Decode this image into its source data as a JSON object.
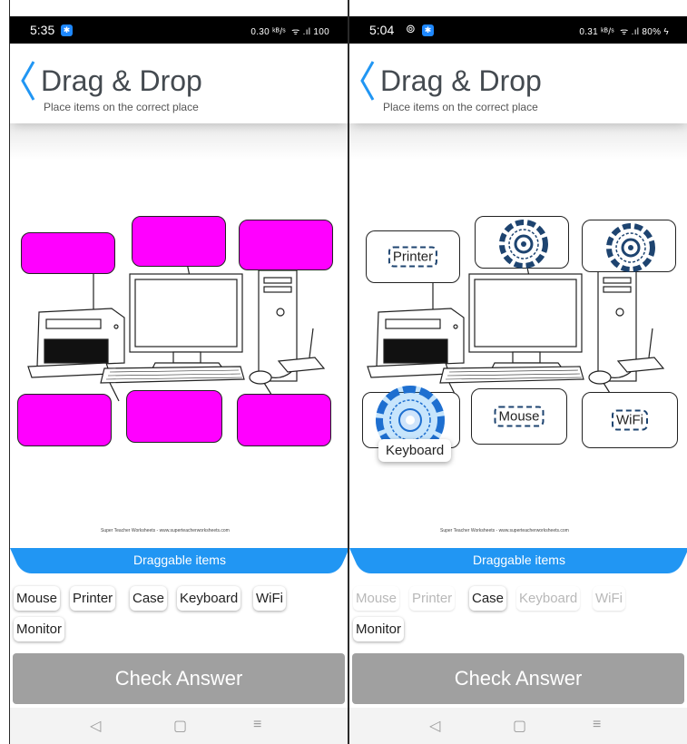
{
  "left": {
    "status": {
      "time": "5:35",
      "right": "   0.30 ᵏᴮ/ˢ  ᯤ .ıl 100"
    },
    "header": {
      "title": "Drag & Drop",
      "subtitle": "Place items on the correct place"
    },
    "credit": "Super Teacher Worksheets - www.superteacherworksheets.com",
    "drag_bar": "Draggable items",
    "items": [
      {
        "label": "Mouse"
      },
      {
        "label": "Printer"
      },
      {
        "label": "Case"
      },
      {
        "label": "Keyboard"
      },
      {
        "label": "WiFi"
      },
      {
        "label": "Monitor"
      }
    ],
    "check_label": "Check Answer"
  },
  "right": {
    "status": {
      "time": "5:04",
      "right": "0.31 ᵏᴮ/ˢ  ᯤ .ıl 80% ϟ"
    },
    "header": {
      "title": "Drag & Drop",
      "subtitle": "Place items on the correct place"
    },
    "credit": "Super Teacher Worksheets - www.superteacherworksheets.com",
    "placed": {
      "printer": "Printer",
      "mouse": "Mouse",
      "wifi": "WiFi"
    },
    "floating": "Keyboard",
    "drag_bar": "Draggable items",
    "items": [
      {
        "label": "Mouse",
        "used": true
      },
      {
        "label": "Printer",
        "used": true
      },
      {
        "label": "Case",
        "used": false
      },
      {
        "label": "Keyboard",
        "used": true
      },
      {
        "label": "WiFi",
        "used": true
      },
      {
        "label": "Monitor",
        "used": false
      }
    ],
    "check_label": "Check Answer"
  },
  "colors": {
    "accent": "#2196f3",
    "drop_fill": "#ff00ff",
    "button": "#a0a0a0",
    "target": "#1e4470"
  }
}
